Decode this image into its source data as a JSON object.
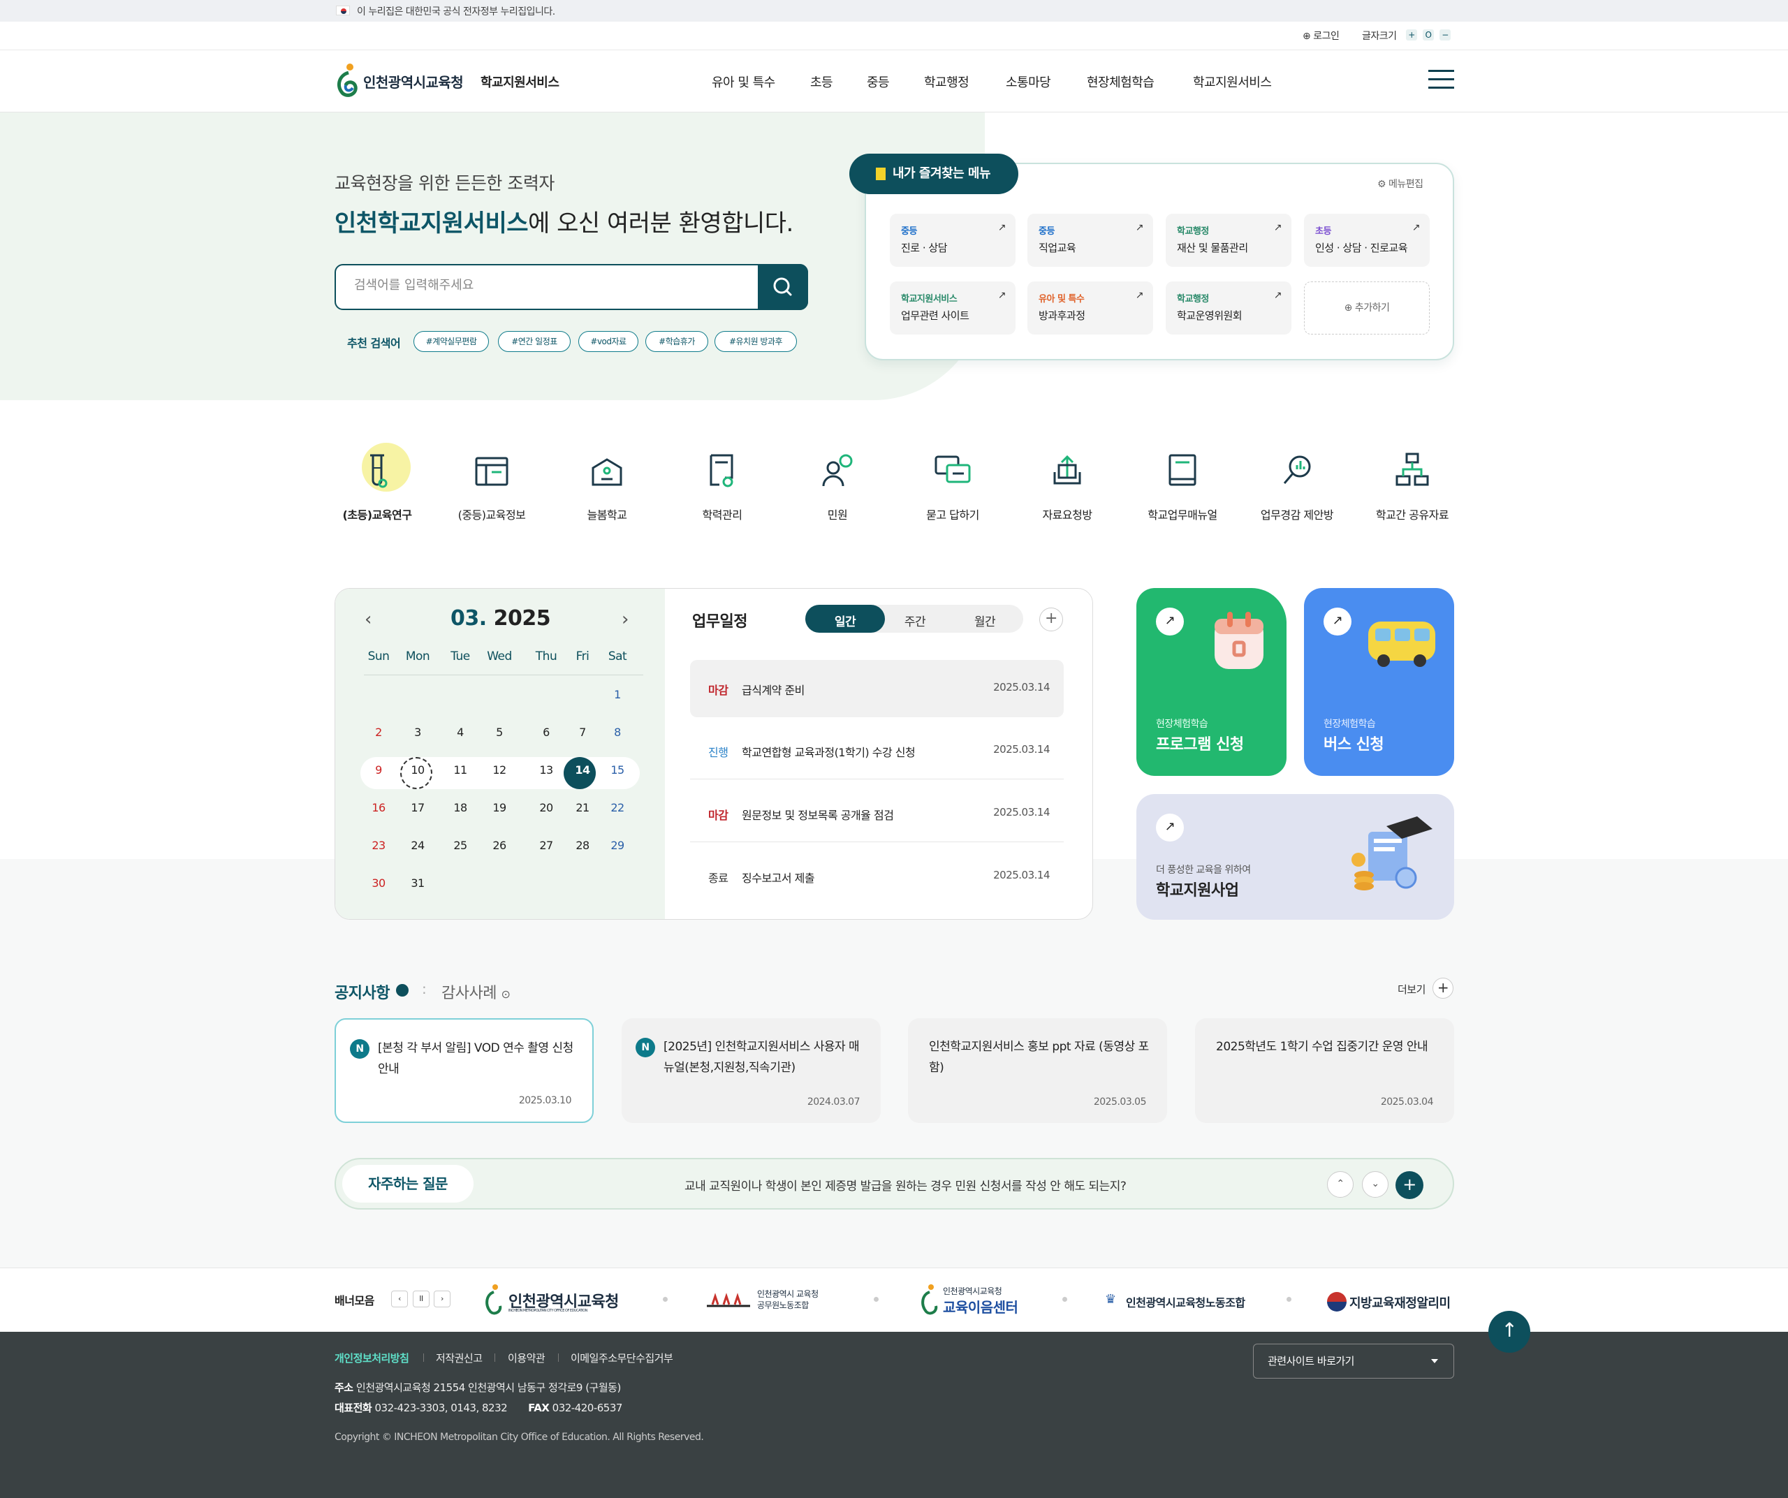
{
  "gov_banner": {
    "text": "이 누리집은 대한민국 공식 전자정부 누리집입니다."
  },
  "util": {
    "login": "로그인",
    "font_size": "글자크기",
    "plus": "+",
    "reset": "O",
    "minus": "−"
  },
  "header": {
    "org": "인천광역시교육청",
    "service": "학교지원서비스",
    "nav": [
      "유아 및 특수",
      "초등",
      "중등",
      "학교행정",
      "소통마당",
      "현장체험학습",
      "학교지원서비스"
    ]
  },
  "hero": {
    "subtitle": "교육현장을 위한 든든한 조력자",
    "title_strong": "인천학교지원서비스",
    "title_rest": "에 오신 여러분 환영합니다.",
    "search_placeholder": "검색어를 입력해주세요",
    "rec_label": "추천 검색어",
    "tags": [
      "#계약실무편람",
      "#연간 일정표",
      "#vod자료",
      "#학습휴가",
      "#유치원 방과후"
    ]
  },
  "favorites": {
    "title": "내가 즐겨찾는 메뉴",
    "edit": "메뉴편집",
    "items": [
      {
        "category": "중등",
        "name": "진로 · 상담",
        "color": "#1e6fc9"
      },
      {
        "category": "중등",
        "name": "직업교육",
        "color": "#1e6fc9"
      },
      {
        "category": "학교행정",
        "name": "재산 및 물품관리",
        "color": "#2a8a6a"
      },
      {
        "category": "초등",
        "name": "인성 · 상담 · 진로교육",
        "color": "#7b4fd0"
      },
      {
        "category": "학교지원서비스",
        "name": "업무관련 사이트",
        "color": "#2a8a6a"
      },
      {
        "category": "유아 및 특수",
        "name": "방과후과정",
        "color": "#e0622a"
      },
      {
        "category": "학교행정",
        "name": "학교운영위원회",
        "color": "#2a8a6a"
      }
    ],
    "add": "추가하기"
  },
  "quick_menu": [
    {
      "label": "(초등)교육연구",
      "icon": "flask-icon"
    },
    {
      "label": "(중등)교육정보",
      "icon": "browser-window-icon"
    },
    {
      "label": "늘봄학교",
      "icon": "school-building-icon"
    },
    {
      "label": "학력관리",
      "icon": "certificate-icon"
    },
    {
      "label": "민원",
      "icon": "people-chat-icon"
    },
    {
      "label": "묻고 답하기",
      "icon": "chat-bubbles-icon"
    },
    {
      "label": "자료요청방",
      "icon": "upload-tray-icon"
    },
    {
      "label": "학교업무매뉴얼",
      "icon": "book-icon"
    },
    {
      "label": "업무경감 제안방",
      "icon": "magnifier-chart-icon"
    },
    {
      "label": "학교간 공유자료",
      "icon": "network-icon"
    }
  ],
  "calendar": {
    "month": "03.",
    "year": "2025",
    "dow": [
      "Sun",
      "Mon",
      "Tue",
      "Wed",
      "Thu",
      "Fri",
      "Sat"
    ],
    "weeks": [
      [
        "",
        "",
        "",
        "",
        "",
        "",
        "1"
      ],
      [
        "2",
        "3",
        "4",
        "5",
        "6",
        "7",
        "8"
      ],
      [
        "9",
        "10",
        "11",
        "12",
        "13",
        "14",
        "15"
      ],
      [
        "16",
        "17",
        "18",
        "19",
        "20",
        "21",
        "22"
      ],
      [
        "23",
        "24",
        "25",
        "26",
        "27",
        "28",
        "29"
      ],
      [
        "30",
        "31",
        "",
        "",
        "",
        "",
        ""
      ]
    ]
  },
  "schedule": {
    "title": "업무일정",
    "tabs": [
      "일간",
      "주간",
      "월간"
    ],
    "rows": [
      {
        "status": "마감",
        "color": "#c0262d",
        "title": "급식계약 준비",
        "date": "2025.03.14"
      },
      {
        "status": "진행",
        "color": "#2a82c8",
        "title": "학교연합형 교육과정(1학기) 수강 신청",
        "date": "2025.03.14"
      },
      {
        "status": "마감",
        "color": "#c0262d",
        "title": "원문정보 및 정보목록 공개율 점검",
        "date": "2025.03.14"
      },
      {
        "status": "종료",
        "color": "#333333",
        "title": "징수보고서 제출",
        "date": "2025.03.14"
      }
    ]
  },
  "promo": {
    "program": {
      "sub": "현장체험학습",
      "title": "프로그램 신청"
    },
    "bus": {
      "sub": "현장체험학습",
      "title": "버스 신청"
    },
    "support": {
      "sub": "더 풍성한 교육을 위하여",
      "title": "학교지원사업"
    }
  },
  "notice": {
    "tab_active": "공지사항",
    "tab_other": "감사사례",
    "more": "더보기",
    "cards": [
      {
        "badge": "N",
        "title": "[본청 각 부서 알림] VOD 연수 촬영 신청 안내",
        "date": "2025.03.10"
      },
      {
        "badge": "N",
        "title": "[2025년] 인천학교지원서비스 사용자 매뉴얼(본청,지원청,직속기관)",
        "date": "2024.03.07"
      },
      {
        "badge": "",
        "title": "인천학교지원서비스 홍보 ppt 자료 (동영상 포함)",
        "date": "2025.03.05"
      },
      {
        "badge": "",
        "title": "2025학년도 1학기 수업 집중기간 운영 안내",
        "date": "2025.03.04"
      }
    ]
  },
  "faq": {
    "label": "자주하는 질문",
    "question": "교내 교직원이나 학생이 본인 제증명 발급을 원하는 경우 민원 신청서를 작성 안 해도 되는지?"
  },
  "banners": {
    "label": "배너모음",
    "items": [
      "인천광역시교육청",
      "INCHEON METROPOLITAN CITY OFFICE OF EDUCATION",
      "인천광역시 교육청",
      "공무원노동조합",
      "인천광역시교육청",
      "교육이음센터",
      "인천광역시교육청노동조합",
      "지방교육재정알리미"
    ]
  },
  "footer": {
    "links": [
      "개인정보처리방침",
      "저작권신고",
      "이용약관",
      "이메일주소무단수집거부"
    ],
    "addr_label": "주소",
    "addr": "인천광역시교육청 21554 인천광역시 남동구 정각로9 (구월동)",
    "phone_label": "대표전화",
    "phone": "032-423-3303, 0143, 8232",
    "fax_label": "FAX",
    "fax": "032-420-6537",
    "copyright": "Copyright © INCHEON Metropolitan City Office of Education. All Rights Reserved.",
    "related": "관련사이트 바로가기"
  }
}
